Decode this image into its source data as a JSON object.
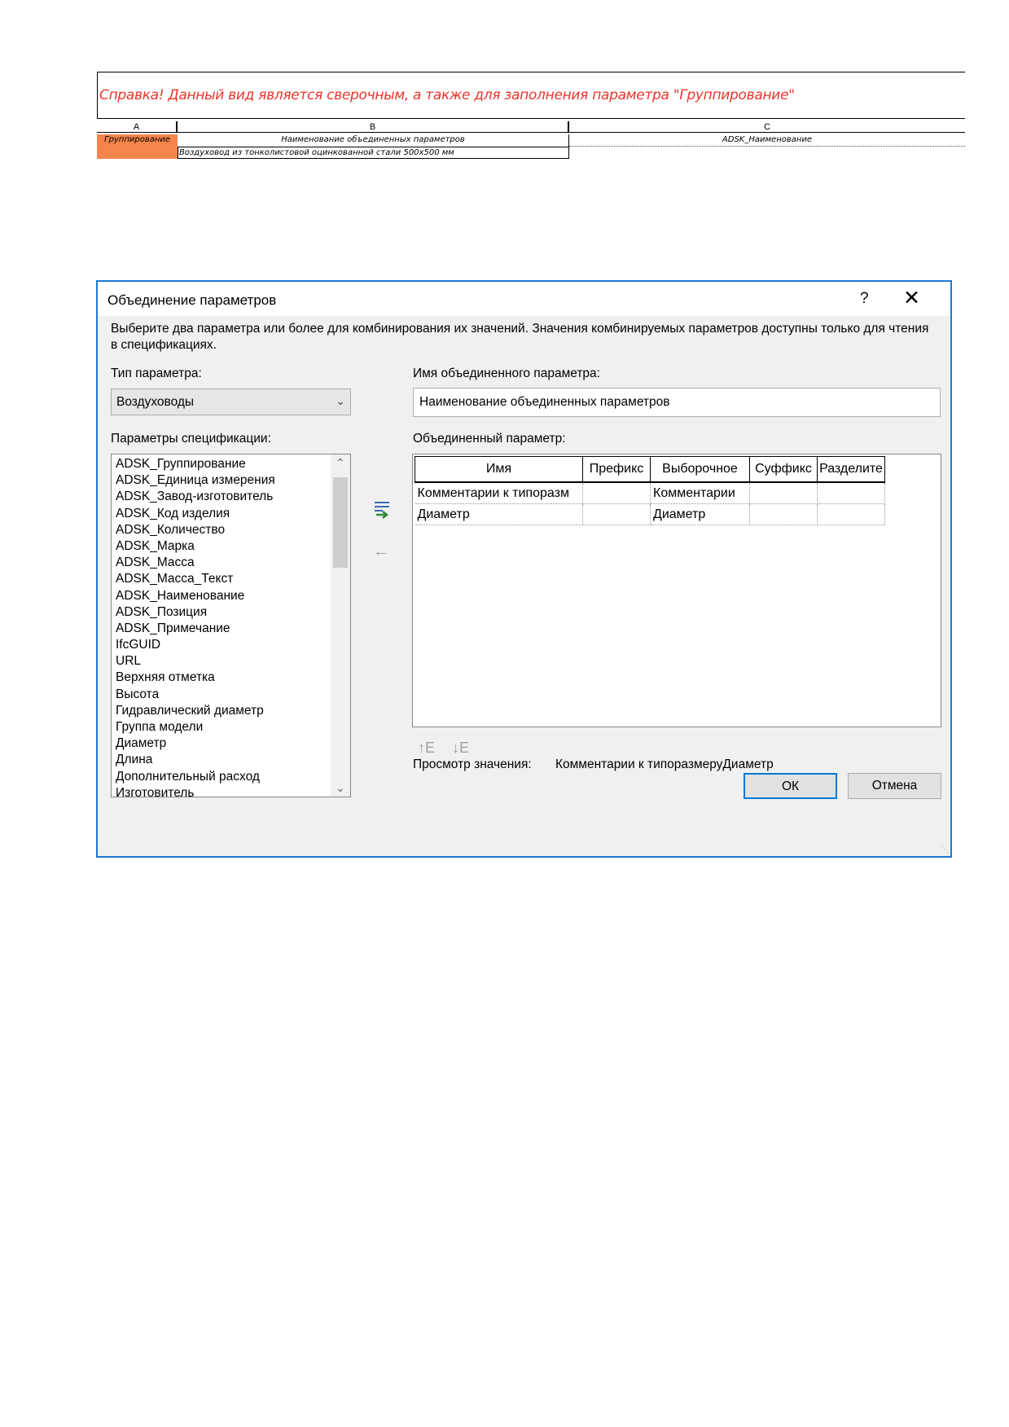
{
  "schedule": {
    "title": "Справка! Данный вид является сверочным, а также для заполнения параметра \"Группирование\"",
    "columns": [
      "A",
      "B",
      "C"
    ],
    "header_row": [
      "Группирование",
      "Наименование объединенных параметров",
      "ADSK_Наименование"
    ],
    "data_row": [
      "",
      "Воздуховод из тонколистовой оцинкованной стали 500x500 мм",
      ""
    ],
    "highlight_color": "#f5854b",
    "title_color": "#e8352b"
  },
  "dialog": {
    "title": "Объединение параметров",
    "help": "?",
    "close": "✕",
    "description": "Выберите два параметра или более для комбинирования их значений.  Значения комбинируемых параметров доступны только для чтения в спецификациях.",
    "param_type_label": "Тип параметра:",
    "param_type_value": "Воздуховоды",
    "combined_name_label": "Имя объединенного параметра:",
    "combined_name_value": "Наименование объединенных параметров",
    "schedule_params_label": "Параметры спецификации:",
    "combined_param_label": "Объединенный параметр:",
    "schedule_params": [
      "ADSK_Группирование",
      "ADSK_Единица измерения",
      "ADSK_Завод-изготовитель",
      "ADSK_Код изделия",
      "ADSK_Количество",
      "ADSK_Марка",
      "ADSK_Масса",
      "ADSK_Масса_Текст",
      "ADSK_Наименование",
      "ADSK_Позиция",
      "ADSK_Примечание",
      "IfcGUID",
      "URL",
      "Верхняя отметка",
      "Высота",
      "Гидравлический диаметр",
      "Группа модели",
      "Диаметр",
      "Длина",
      "Дополнительный расход",
      "Изготовитель"
    ],
    "grid": {
      "headers": [
        "Имя",
        "Префикс",
        "Выборочное",
        "Суффикс",
        "Разделите"
      ],
      "rows": [
        [
          "Комментарии к типоразм",
          "",
          "Комментарии",
          "",
          ""
        ],
        [
          "Диаметр",
          "",
          "Диаметр",
          "",
          ""
        ]
      ]
    },
    "preview_label": "Просмотр значения:",
    "preview_value": "Комментарии к типоразмеруДиаметр",
    "ok": "ОК",
    "cancel": "Отмена",
    "accent_color": "#1f78d1"
  }
}
